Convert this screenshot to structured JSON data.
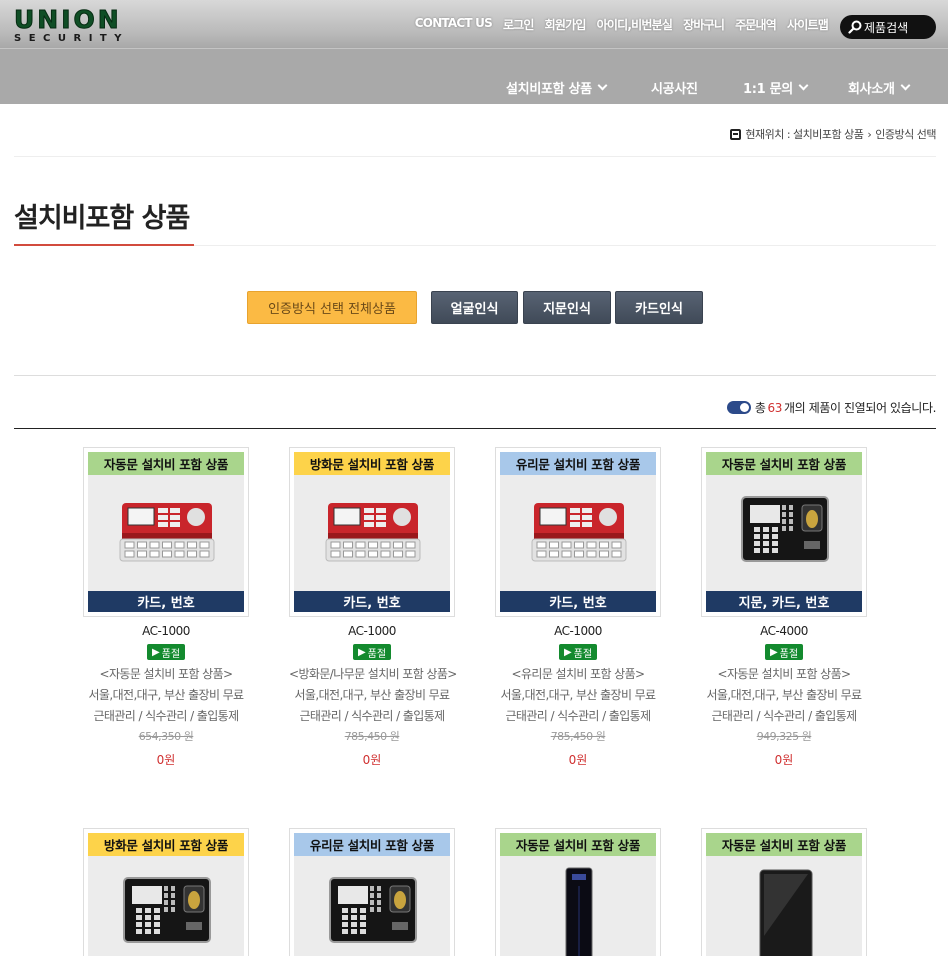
{
  "header": {
    "logo_text": "UNION",
    "logo_sub": "SECURITY",
    "top_links": [
      "CONTACT US",
      "로그인",
      "회원가입",
      "아이디,비번분실",
      "장바구니",
      "주문내역",
      "사이트맵"
    ],
    "search_label": "제품검색"
  },
  "nav": {
    "items": [
      "설치비포함 상품",
      "시공사진",
      "1:1 문의",
      "회사소개"
    ]
  },
  "breadcrumb": {
    "text": "현재위치 : 설치비포함 상품",
    "current": "인증방식 선택"
  },
  "page": {
    "title": "설치비포함 상품"
  },
  "filters": {
    "all": "인증방식 선택 전체상품",
    "face": "얼굴인식",
    "finger": "지문인식",
    "card": "카드인식"
  },
  "count": {
    "prefix": "총 ",
    "number": "63",
    "suffix": "개의 제품이 진열되어 있습니다."
  },
  "colors": {
    "green_tag": "#a9d58c",
    "yellow_tag": "#fdd34a",
    "blue_tag": "#a8c8ea",
    "navy": "#1f3a64",
    "accent_red": "#d03030"
  },
  "products": [
    {
      "tag": "자동문 설치비 포함 상품",
      "tag_color": "green",
      "device": "red",
      "sub": "카드, 번호",
      "model": "AC-1000",
      "badge": "품절",
      "line1": "<자동문 설치비 포함 상품>",
      "line2": "서울,대전,대구, 부산 출장비 무료",
      "line3": "근태관리 / 식수관리 / 출입통제",
      "old_price": "654,350 원",
      "price": "0원"
    },
    {
      "tag": "방화문 설치비 포함 상품",
      "tag_color": "yellow",
      "device": "red",
      "sub": "카드, 번호",
      "model": "AC-1000",
      "badge": "품절",
      "line1": "<방화문/나무문 설치비 포함 상품>",
      "line2": "서울,대전,대구, 부산 출장비 무료",
      "line3": "근태관리 / 식수관리 / 출입통제",
      "old_price": "785,450 원",
      "price": "0원"
    },
    {
      "tag": "유리문 설치비 포함 상품",
      "tag_color": "blue",
      "device": "red",
      "sub": "카드, 번호",
      "model": "AC-1000",
      "badge": "품절",
      "line1": "<유리문 설치비 포함 상품>",
      "line2": "서울,대전,대구, 부산 출장비 무료",
      "line3": "근태관리 / 식수관리 / 출입통제",
      "old_price": "785,450 원",
      "price": "0원"
    },
    {
      "tag": "자동문 설치비 포함 상품",
      "tag_color": "green",
      "device": "black",
      "sub": "지문, 카드, 번호",
      "model": "AC-4000",
      "badge": "품절",
      "line1": "<자동문 설치비 포함 상품>",
      "line2": "서울,대전,대구, 부산 출장비 무료",
      "line3": "근태관리 / 식수관리 / 출입통제",
      "old_price": "949,325 원",
      "price": "0원"
    },
    {
      "tag": "방화문 설치비 포함 상품",
      "tag_color": "yellow",
      "device": "black"
    },
    {
      "tag": "유리문 설치비 포함 상품",
      "tag_color": "blue",
      "device": "black"
    },
    {
      "tag": "자동문 설치비 포함 상품",
      "tag_color": "green",
      "device": "slim"
    },
    {
      "tag": "자동문 설치비 포함 상품",
      "tag_color": "green",
      "device": "pad"
    }
  ]
}
